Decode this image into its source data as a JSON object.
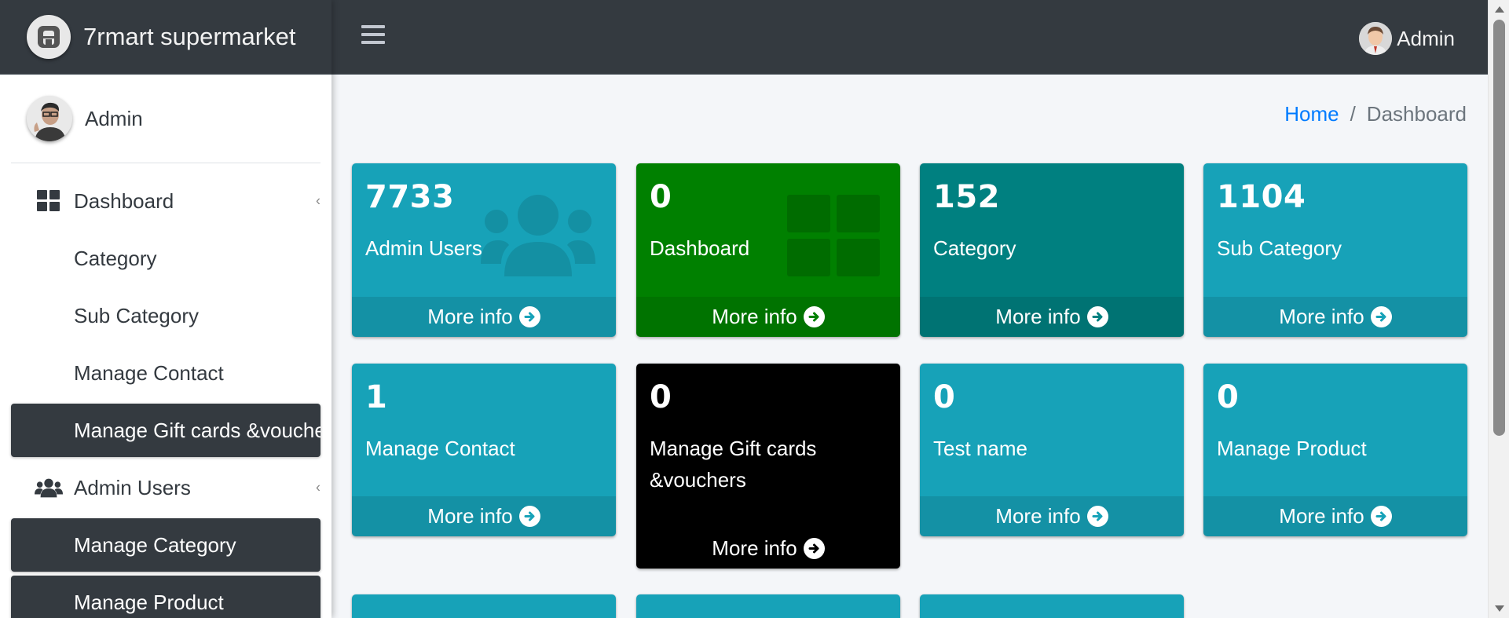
{
  "brand": {
    "name": "7rmart supermarket"
  },
  "sidebar_user": {
    "name": "Admin"
  },
  "sidebar": {
    "items": [
      {
        "label": "Dashboard"
      },
      {
        "label": "Category"
      },
      {
        "label": "Sub Category"
      },
      {
        "label": "Manage Contact"
      },
      {
        "label": "Manage Gift cards &vouchers"
      },
      {
        "label": "Admin Users"
      },
      {
        "label": "Manage Category"
      },
      {
        "label": "Manage Product"
      }
    ]
  },
  "topbar": {
    "user_name": "Admin"
  },
  "breadcrumb": {
    "home": "Home",
    "separator": "/",
    "current": "Dashboard"
  },
  "cards": [
    {
      "count": "7733",
      "label": "Admin Users",
      "link": "More info",
      "color": "#17a2b8"
    },
    {
      "count": "0",
      "label": "Dashboard",
      "link": "More info",
      "color": "#008000"
    },
    {
      "count": "152",
      "label": "Category",
      "link": "More info",
      "color": "#008080"
    },
    {
      "count": "1104",
      "label": "Sub Category",
      "link": "More info",
      "color": "#17a2b8"
    },
    {
      "count": "1",
      "label": "Manage Contact",
      "link": "More info",
      "color": "#17a2b8"
    },
    {
      "count": "0",
      "label": "Manage Gift cards &vouchers",
      "link": "More info",
      "color": "#000000"
    },
    {
      "count": "0",
      "label": "Test name",
      "link": "More info",
      "color": "#17a2b8"
    },
    {
      "count": "0",
      "label": "Manage Product",
      "link": "More info",
      "color": "#17a2b8"
    }
  ]
}
